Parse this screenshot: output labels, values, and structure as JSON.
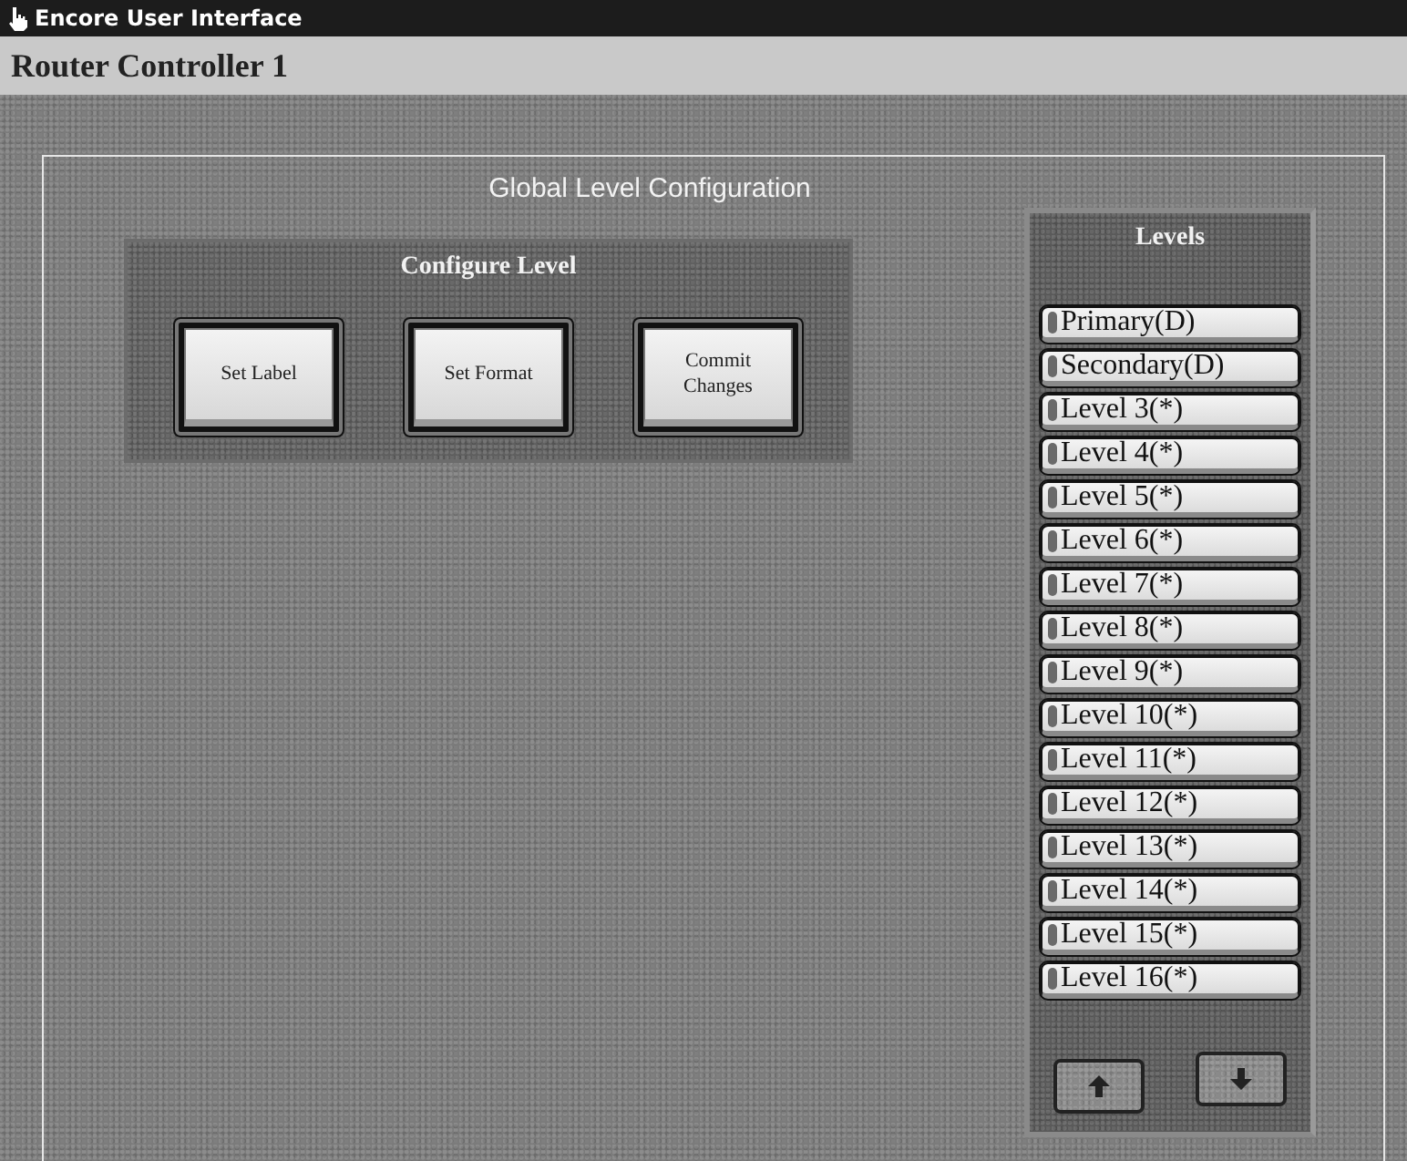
{
  "window": {
    "title": "Encore User Interface"
  },
  "header": {
    "title": "Router Controller 1"
  },
  "frame": {
    "title": "Global Level Configuration"
  },
  "configure_panel": {
    "title": "Configure Level",
    "buttons": [
      {
        "label": "Set Label"
      },
      {
        "label": "Set Format"
      },
      {
        "label": "Commit Changes"
      }
    ]
  },
  "levels_panel": {
    "title": "Levels",
    "items": [
      {
        "label": "Primary(D)"
      },
      {
        "label": "Secondary(D)"
      },
      {
        "label": "Level 3(*)"
      },
      {
        "label": "Level 4(*)"
      },
      {
        "label": "Level 5(*)"
      },
      {
        "label": "Level 6(*)"
      },
      {
        "label": "Level 7(*)"
      },
      {
        "label": "Level 8(*)"
      },
      {
        "label": "Level 9(*)"
      },
      {
        "label": "Level 10(*)"
      },
      {
        "label": "Level 11(*)"
      },
      {
        "label": "Level 12(*)"
      },
      {
        "label": "Level 13(*)"
      },
      {
        "label": "Level 14(*)"
      },
      {
        "label": "Level 15(*)"
      },
      {
        "label": "Level 16(*)"
      }
    ]
  }
}
